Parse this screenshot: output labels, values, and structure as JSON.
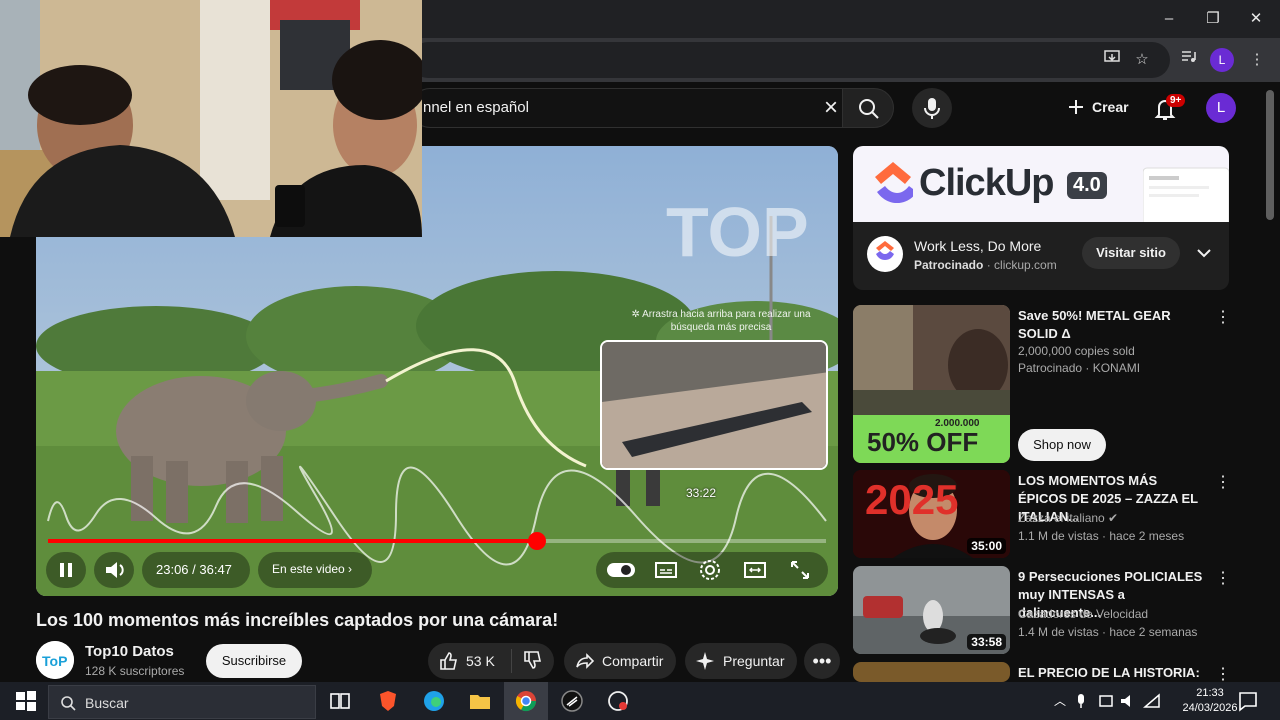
{
  "browser": {
    "window_controls": [
      "–",
      "❐",
      "✕"
    ]
  },
  "youtube_header": {
    "search_query": "nnel en español",
    "create_label": "Crear",
    "notification_badge": "9+",
    "avatar_letter": "L"
  },
  "player": {
    "drag_hint": "✲ Arrastra hacia arriba para realizar una búsqueda más precisa",
    "preview_time": "33:22",
    "current_time": "23:06 / 36:47",
    "chapter_label": "En este video ›",
    "progress_fraction": 0.628,
    "watermark": "TOP"
  },
  "video": {
    "title": "Los 100 momentos más increíbles captados por una cámara!",
    "channel_name": "Top10 Datos",
    "subscribers": "128 K suscriptores",
    "subscribe_label": "Suscribirse",
    "likes": "53 K",
    "share_label": "Compartir",
    "ask_label": "Preguntar"
  },
  "ad": {
    "brand": "ClickUp",
    "version": "4.0",
    "headline": "Work Less, Do More",
    "sponsored": "Patrocinado",
    "domain": "· clickup.com",
    "visit_label": "Visitar sitio",
    "logo_caption": "ClickUp"
  },
  "recommendations": [
    {
      "title": "Save 50%! METAL GEAR SOLID Δ",
      "line1": "2,000,000 copies sold",
      "line2": "Patrocinado · KONAMI",
      "thumb_badge": "50% OFF",
      "thumb_badge_top": "2.000.000",
      "cta": "Shop now"
    },
    {
      "title": "LOS MOMENTOS MÁS ÉPICOS DE 2025 – ZAZZA EL ITALIAN...",
      "line1": "Zazza el italiano ✔",
      "line2": "1.1 M de vistas · hace 2 meses",
      "duration": "35:00",
      "thumb_text": "2025"
    },
    {
      "title": "9 Persecuciones POLICIALES muy INTENSAS a dalincuente...",
      "line1": "Cazadores de Velocidad",
      "line2": "1.4 M de vistas · hace 2 semanas",
      "duration": "33:58"
    },
    {
      "title": "EL PRECIO DE LA HISTORIA:"
    }
  ],
  "taskbar": {
    "search_placeholder": "Buscar",
    "time": "21:33",
    "date": "24/03/2026"
  }
}
